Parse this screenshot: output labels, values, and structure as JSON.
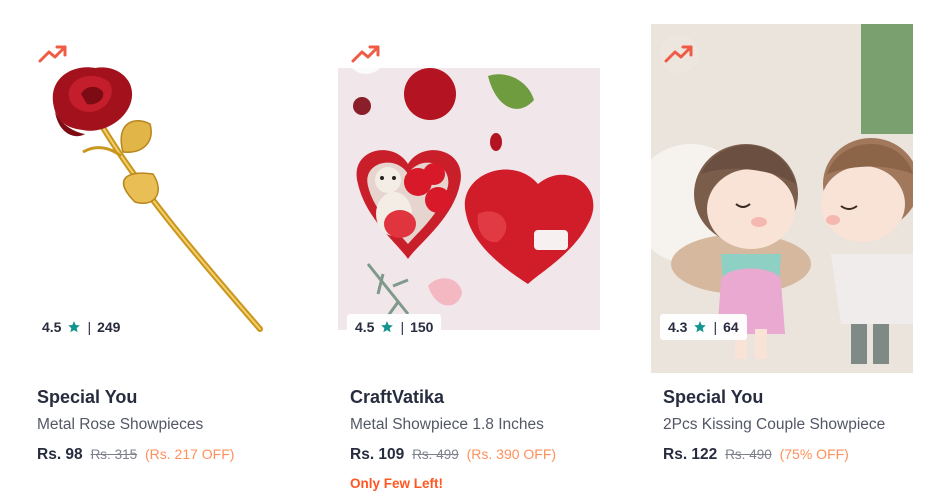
{
  "products": [
    {
      "rating": "4.5",
      "reviews": "249",
      "brand": "Special You",
      "name": "Metal Rose Showpieces",
      "price": "Rs. 98",
      "mrp": "Rs. 315",
      "discount": "(Rs. 217 OFF)",
      "stock_note": ""
    },
    {
      "rating": "4.5",
      "reviews": "150",
      "brand": "CraftVatika",
      "name": "Metal Showpiece 1.8 Inches",
      "price": "Rs. 109",
      "mrp": "Rs. 499",
      "discount": "(Rs. 390 OFF)",
      "stock_note": "Only Few Left!"
    },
    {
      "rating": "4.3",
      "reviews": "64",
      "brand": "Special You",
      "name": "2Pcs Kissing Couple Showpiece",
      "price": "Rs. 122",
      "mrp": "Rs. 490",
      "discount": "(75% OFF)",
      "stock_note": ""
    }
  ],
  "icons": {
    "trending": "trending-up-icon",
    "star": "star-icon"
  },
  "colors": {
    "trending": "#ef5b45",
    "star": "#14958f",
    "discount": "#ff905a",
    "few_left": "#ff5722",
    "brand_text": "#282c3f",
    "name_text": "#535766"
  }
}
